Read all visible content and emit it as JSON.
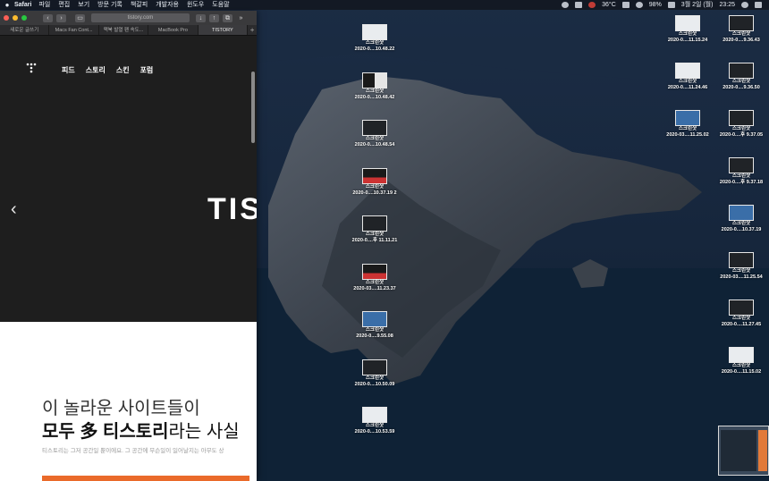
{
  "menubar": {
    "apple": "",
    "app": "Safari",
    "items": [
      "파일",
      "편집",
      "보기",
      "방문 기록",
      "책갈피",
      "개발자용",
      "윈도우",
      "도움말"
    ],
    "temperature": "36°C",
    "date": "3월 2일 (월)",
    "time": "23:25",
    "battery": "98%"
  },
  "safari": {
    "address": "tistory.com",
    "tabs": [
      "새로운 글쓰기",
      "Macs Fan Cont...",
      "맥북 발열 팬 속도...",
      "MacBook Pro",
      "TISTORY"
    ],
    "active_tab": 4,
    "new_tab": "+"
  },
  "page": {
    "nav": [
      "피드",
      "스토리",
      "스킨",
      "포럼"
    ],
    "hero_text": "TIS",
    "prev_arrow": "‹",
    "headline1": "이 놀라운 사이트들이",
    "headline2_bold": "모두 多 티스토리",
    "headline2_light": "라는 사실",
    "description": "티스토리는 그저 공간일 뿐이에요. 그 공간에 무슨일이 일어날지는 아무도 상"
  },
  "desktop": {
    "center_column": [
      {
        "title": "스크린샷",
        "name": "2020-0....10.48.22",
        "style": "light"
      },
      {
        "title": "스크린샷",
        "name": "2020-0....10.48.42",
        "style": "mixed"
      },
      {
        "title": "스크린샷",
        "name": "2020-0....10.48.54",
        "style": "dark"
      },
      {
        "title": "스크린샷",
        "name": "2020-0....10.37.19 2",
        "style": "red"
      },
      {
        "title": "스크린샷",
        "name": "2020-0....후 11.11.21",
        "style": "dark"
      },
      {
        "title": "스크린샷",
        "name": "2020-03....11.23.37",
        "style": "red"
      },
      {
        "title": "스크린샷",
        "name": "2020-0....9.55.08",
        "style": "blue"
      },
      {
        "title": "스크린샷",
        "name": "2020-0....10.50.09",
        "style": "dark"
      },
      {
        "title": "스크린샷",
        "name": "2020-0....10.53.59",
        "style": "light"
      }
    ],
    "right_column_a": [
      {
        "title": "스크린샷",
        "name": "2020-0....11.15.24",
        "style": "light"
      },
      {
        "title": "스크린샷",
        "name": "2020-0....11.24.46",
        "style": "light"
      },
      {
        "title": "스크린샷",
        "name": "2020-03....11.25.02",
        "style": "blue"
      }
    ],
    "right_column_b": [
      {
        "title": "스크린샷",
        "name": "2020-0....9.36.43",
        "style": "dark"
      },
      {
        "title": "스크린샷",
        "name": "2020-0....9.36.50",
        "style": "dark"
      },
      {
        "title": "스크린샷",
        "name": "2020-0....후 9.37.05",
        "style": "dark"
      },
      {
        "title": "스크린샷",
        "name": "2020-0....후 9.37.18",
        "style": "dark"
      },
      {
        "title": "스크린샷",
        "name": "2020-0....10.37.19",
        "style": "blue"
      },
      {
        "title": "스크린샷",
        "name": "2020-03....11.25.54",
        "style": "dark"
      },
      {
        "title": "스크린샷",
        "name": "2020-0....11.27.45",
        "style": "dark"
      },
      {
        "title": "스크린샷",
        "name": "2020-0....11.15.02",
        "style": "light"
      }
    ]
  }
}
